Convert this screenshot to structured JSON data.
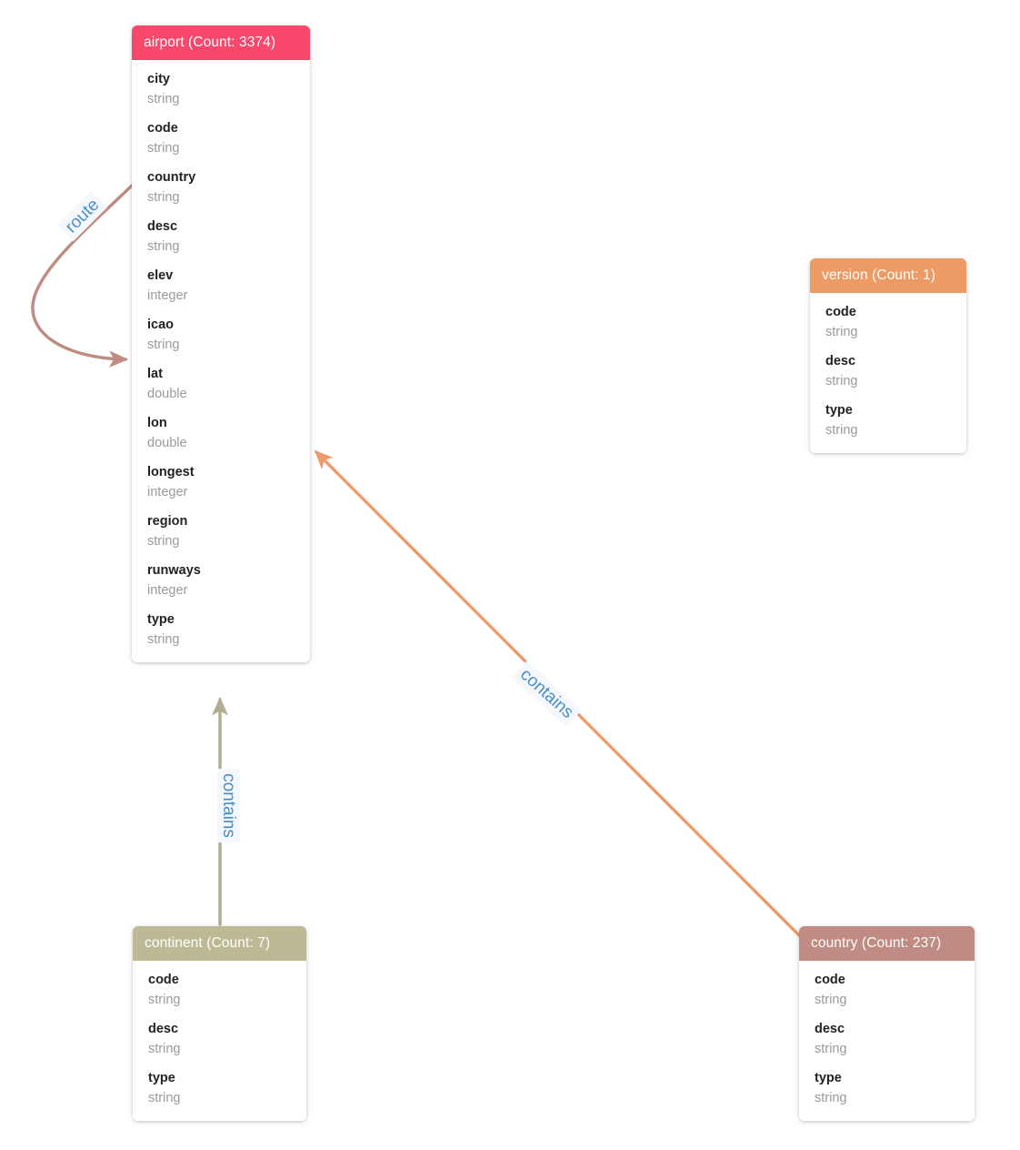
{
  "diagram": {
    "type": "schema-graph",
    "background_color": "#ffffff",
    "nodes": [
      {
        "id": "airport",
        "name": "airport",
        "count": 3374,
        "header_label": "airport (Count: 3374)",
        "header_color": "#f9486b",
        "fields": [
          {
            "name": "city",
            "type": "string"
          },
          {
            "name": "code",
            "type": "string"
          },
          {
            "name": "country",
            "type": "string"
          },
          {
            "name": "desc",
            "type": "string"
          },
          {
            "name": "elev",
            "type": "integer"
          },
          {
            "name": "icao",
            "type": "string"
          },
          {
            "name": "lat",
            "type": "double"
          },
          {
            "name": "lon",
            "type": "double"
          },
          {
            "name": "longest",
            "type": "integer"
          },
          {
            "name": "region",
            "type": "string"
          },
          {
            "name": "runways",
            "type": "integer"
          },
          {
            "name": "type",
            "type": "string"
          }
        ]
      },
      {
        "id": "version",
        "name": "version",
        "count": 1,
        "header_label": "version (Count: 1)",
        "header_color": "#ee9a64",
        "fields": [
          {
            "name": "code",
            "type": "string"
          },
          {
            "name": "desc",
            "type": "string"
          },
          {
            "name": "type",
            "type": "string"
          }
        ]
      },
      {
        "id": "continent",
        "name": "continent",
        "count": 7,
        "header_label": "continent (Count: 7)",
        "header_color": "#bdb994",
        "fields": [
          {
            "name": "code",
            "type": "string"
          },
          {
            "name": "desc",
            "type": "string"
          },
          {
            "name": "type",
            "type": "string"
          }
        ]
      },
      {
        "id": "country",
        "name": "country",
        "count": 237,
        "header_label": "country (Count: 237)",
        "header_color": "#c08b82",
        "fields": [
          {
            "name": "code",
            "type": "string"
          },
          {
            "name": "desc",
            "type": "string"
          },
          {
            "name": "type",
            "type": "string"
          }
        ]
      }
    ],
    "edges": [
      {
        "id": "route",
        "label": "route",
        "source": "airport",
        "target": "airport",
        "color": "#c08b82",
        "self_loop": true
      },
      {
        "id": "contains-continent-airport",
        "label": "contains",
        "source": "continent",
        "target": "airport",
        "color": "#b0ad90",
        "self_loop": false
      },
      {
        "id": "contains-country-airport",
        "label": "contains",
        "source": "country",
        "target": "airport",
        "color": "#ed9a6d",
        "self_loop": false
      }
    ],
    "edge_label_style": {
      "text_color": "#4a8fc4",
      "background_color": "#f4f7fb"
    }
  }
}
